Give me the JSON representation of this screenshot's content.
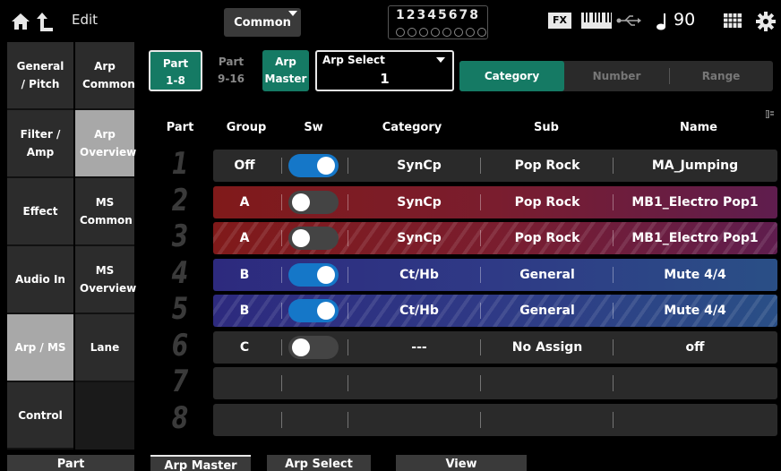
{
  "header": {
    "title": "Edit",
    "common_label": "Common",
    "part_numbers": "12345678",
    "fx_label": "FX",
    "tempo": "90"
  },
  "sidebar_primary": [
    {
      "label": "General / Pitch",
      "selected": false
    },
    {
      "label": "Filter / Amp",
      "selected": false
    },
    {
      "label": "Effect",
      "selected": false
    },
    {
      "label": "Audio In",
      "selected": false
    },
    {
      "label": "Arp / MS",
      "selected": true
    },
    {
      "label": "Control",
      "selected": false
    }
  ],
  "sidebar_secondary": [
    {
      "label": "Arp Common",
      "selected": false
    },
    {
      "label": "Arp Overview",
      "selected": true
    },
    {
      "label": "MS Common",
      "selected": false
    },
    {
      "label": "MS Overview",
      "selected": false
    },
    {
      "label": "Lane",
      "selected": false
    }
  ],
  "controls": {
    "part_1_8_line1": "Part",
    "part_1_8_line2": "1-8",
    "part_9_16_line1": "Part",
    "part_9_16_line2": "9-16",
    "arp_master_line1": "Arp",
    "arp_master_line2": "Master",
    "arp_select_label": "Arp Select",
    "arp_select_value": "1",
    "view_modes": [
      "Category",
      "Number",
      "Range"
    ],
    "active_view_mode": "Category"
  },
  "table": {
    "headers": {
      "part": "Part",
      "group": "Group",
      "sw": "Sw",
      "category": "Category",
      "sub": "Sub",
      "name": "Name"
    },
    "rows": [
      {
        "part": "1",
        "group": "Off",
        "sw": "on",
        "category": "SynCp",
        "sub": "Pop Rock",
        "name": "MA_Jumping",
        "color": "gray",
        "hatched": false
      },
      {
        "part": "2",
        "group": "A",
        "sw": "off",
        "category": "SynCp",
        "sub": "Pop Rock",
        "name": "MB1_Electro Pop1",
        "color": "red",
        "hatched": false
      },
      {
        "part": "3",
        "group": "A",
        "sw": "off",
        "category": "SynCp",
        "sub": "Pop Rock",
        "name": "MB1_Electro Pop1",
        "color": "red",
        "hatched": true
      },
      {
        "part": "4",
        "group": "B",
        "sw": "on",
        "category": "Ct/Hb",
        "sub": "General",
        "name": "Mute 4/4",
        "color": "blue",
        "hatched": false
      },
      {
        "part": "5",
        "group": "B",
        "sw": "on",
        "category": "Ct/Hb",
        "sub": "General",
        "name": "Mute 4/4",
        "color": "blue",
        "hatched": true
      },
      {
        "part": "6",
        "group": "C",
        "sw": "off",
        "category": "---",
        "sub": "No Assign",
        "name": "off",
        "color": "gray",
        "hatched": false
      },
      {
        "part": "7",
        "group": "",
        "sw": "",
        "category": "",
        "sub": "",
        "name": "",
        "color": "gray",
        "hatched": false
      },
      {
        "part": "8",
        "group": "",
        "sw": "",
        "category": "",
        "sub": "",
        "name": "",
        "color": "gray",
        "hatched": false
      }
    ]
  },
  "bottom_tabs": [
    {
      "label": "Part",
      "selected": false
    },
    {
      "label": "Arp Master",
      "selected": true
    },
    {
      "label": "Arp Select",
      "selected": false
    },
    {
      "label": "View",
      "selected": false
    }
  ]
}
